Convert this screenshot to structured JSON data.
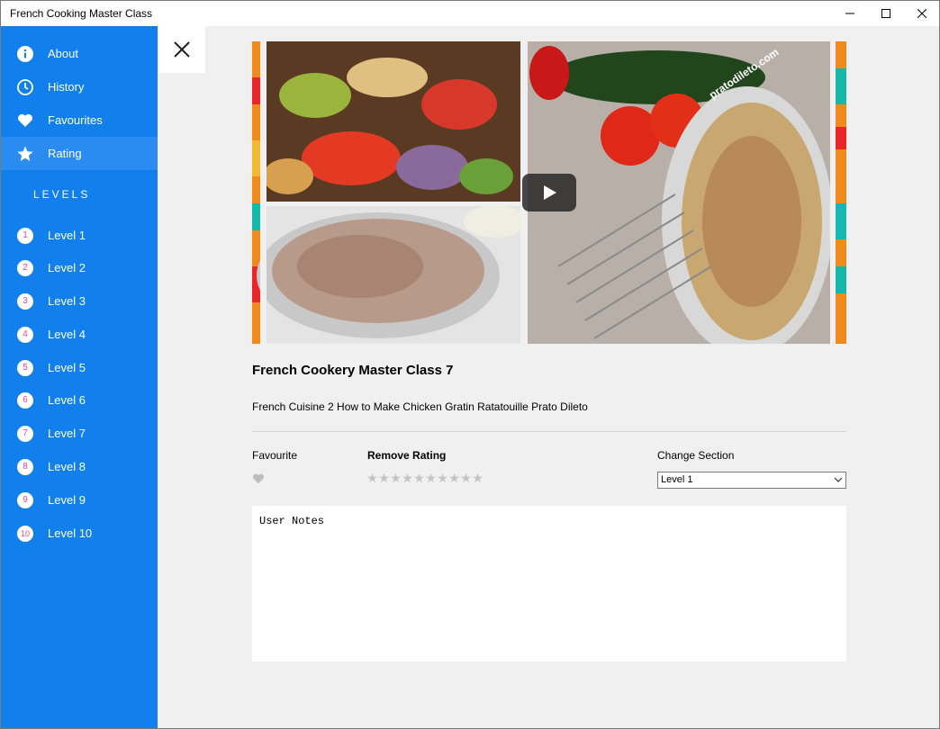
{
  "window": {
    "title": "French Cooking Master Class"
  },
  "sidebar": {
    "items": [
      {
        "label": "About",
        "icon": "info-icon"
      },
      {
        "label": "History",
        "icon": "clock-icon"
      },
      {
        "label": "Favourites",
        "icon": "heart-icon"
      },
      {
        "label": "Rating",
        "icon": "star-icon"
      }
    ],
    "selected": "Rating",
    "levels_header": "LEVELS",
    "levels": [
      {
        "number": "1",
        "label": "Level 1"
      },
      {
        "number": "2",
        "label": "Level 2"
      },
      {
        "number": "3",
        "label": "Level 3"
      },
      {
        "number": "4",
        "label": "Level 4"
      },
      {
        "number": "5",
        "label": "Level 5"
      },
      {
        "number": "6",
        "label": "Level 6"
      },
      {
        "number": "7",
        "label": "Level 7"
      },
      {
        "number": "8",
        "label": "Level 8"
      },
      {
        "number": "9",
        "label": "Level 9"
      },
      {
        "number": "10",
        "label": "Level 10"
      }
    ]
  },
  "video": {
    "watermark": "pratodileto.com",
    "title": "French Cookery Master Class 7",
    "description": "French Cuisine 2 How to Make Chicken Gratin Ratatouille Prato Dileto"
  },
  "details": {
    "favourite_label": "Favourite",
    "rating_label": "Remove Rating",
    "rating_max": 10,
    "rating_value": 0,
    "section_label": "Change Section",
    "section_value": "Level 1"
  },
  "notes": {
    "value": "User Notes"
  },
  "colors": {
    "sidebar": "#1180ec",
    "badge_text": "#e84a8a",
    "background": "#f0f0f0"
  }
}
